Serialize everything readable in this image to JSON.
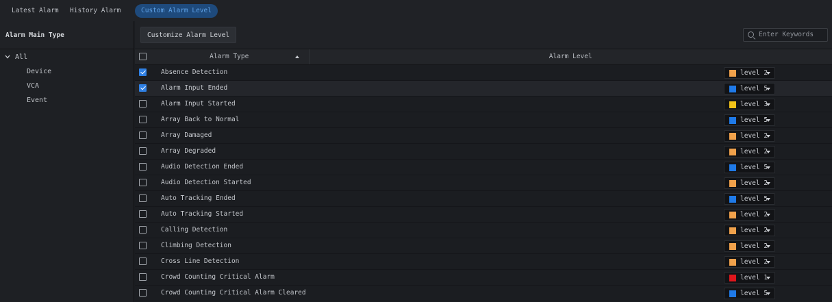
{
  "tabs": [
    {
      "label": "Latest Alarm"
    },
    {
      "label": "History Alarm"
    },
    {
      "label": "Custom Alarm Level"
    }
  ],
  "left": {
    "header": "Alarm Main Type",
    "root": "All",
    "items": [
      {
        "label": "Device"
      },
      {
        "label": "VCA"
      },
      {
        "label": "Event"
      }
    ]
  },
  "toolbar": {
    "customize_label": "Customize Alarm Level",
    "search_placeholder": "Enter Keywords"
  },
  "table": {
    "col_type": "Alarm Type",
    "col_level": "Alarm Level",
    "rows": [
      {
        "type": "Absence Detection",
        "checked": true,
        "level": "level 2",
        "color": "#f0a14b"
      },
      {
        "type": "Alarm Input Ended",
        "checked": true,
        "level": "level 5",
        "color": "#1f7ae8"
      },
      {
        "type": "Alarm Input Started",
        "checked": false,
        "level": "level 3",
        "color": "#f2c318"
      },
      {
        "type": "Array Back to Normal",
        "checked": false,
        "level": "level 5",
        "color": "#1f7ae8"
      },
      {
        "type": "Array Damaged",
        "checked": false,
        "level": "level 2",
        "color": "#f0a14b"
      },
      {
        "type": "Array Degraded",
        "checked": false,
        "level": "level 2",
        "color": "#f0a14b"
      },
      {
        "type": "Audio Detection Ended",
        "checked": false,
        "level": "level 5",
        "color": "#1f7ae8"
      },
      {
        "type": "Audio Detection Started",
        "checked": false,
        "level": "level 2",
        "color": "#f0a14b"
      },
      {
        "type": "Auto Tracking Ended",
        "checked": false,
        "level": "level 5",
        "color": "#1f7ae8"
      },
      {
        "type": "Auto Tracking Started",
        "checked": false,
        "level": "level 2",
        "color": "#f0a14b"
      },
      {
        "type": "Calling Detection",
        "checked": false,
        "level": "level 2",
        "color": "#f0a14b"
      },
      {
        "type": "Climbing Detection",
        "checked": false,
        "level": "level 2",
        "color": "#f0a14b"
      },
      {
        "type": "Cross Line Detection",
        "checked": false,
        "level": "level 2",
        "color": "#f0a14b"
      },
      {
        "type": "Crowd Counting Critical Alarm",
        "checked": false,
        "level": "level 1",
        "color": "#e0161c"
      },
      {
        "type": "Crowd Counting Critical Alarm Cleared",
        "checked": false,
        "level": "level 5",
        "color": "#1f7ae8"
      }
    ]
  }
}
